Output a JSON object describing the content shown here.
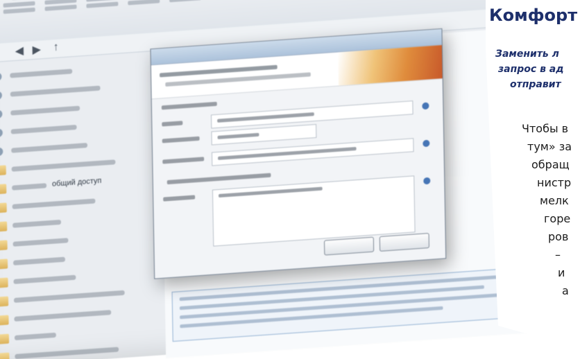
{
  "screen": {
    "tree_label": "общий доступ"
  },
  "magazine": {
    "title": "Комфорт",
    "lead_lines": [
      "Заменить л",
      "запрос в ад",
      "отправит"
    ],
    "body_lines": [
      "Чтобы в",
      "тум» за",
      "обращ",
      "нистр",
      "мелк",
      "горе",
      "ров",
      "–",
      "и",
      "а"
    ]
  }
}
